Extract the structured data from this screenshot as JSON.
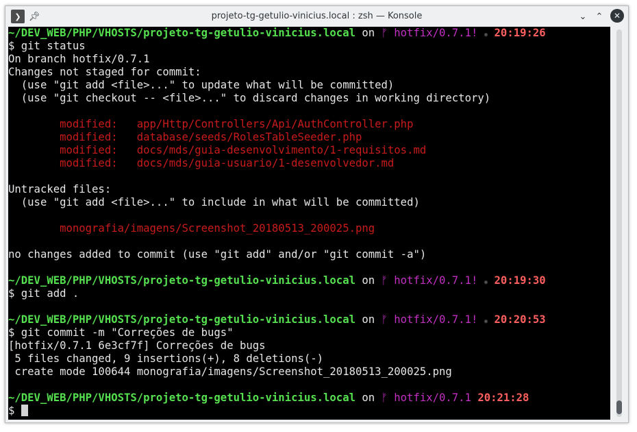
{
  "window": {
    "title": "projeto-tg-getulio-vinicius.local : zsh — Konsole"
  },
  "icons": {
    "menu": "terminal-menu-icon",
    "pin": "pin-icon",
    "minimize": "chevron-down-icon",
    "maximize": "chevron-up-icon",
    "close": "close-icon"
  },
  "colors": {
    "path": "#55e04f",
    "branch": "#c22fc2",
    "time": "#ff5f5f",
    "modified": "#c91b1b",
    "background": "#000000"
  },
  "terminal": {
    "prompt_path": "~/DEV_WEB/PHP/VHOSTS/projeto-tg-getulio-vinicius.local",
    "on": "on",
    "branch_glyph": "ᚠ",
    "dirty_marker": "◉",
    "prompts": [
      {
        "branch": "hotfix/0.7.1!",
        "time": "20:19:26",
        "command": "$ git status"
      },
      {
        "branch": "hotfix/0.7.1!",
        "time": "20:19:30",
        "command": "$ git add ."
      },
      {
        "branch": "hotfix/0.7.1!",
        "time": "20:20:53",
        "command": "$ git commit -m \"Correções de bugs\""
      },
      {
        "branch": "hotfix/0.7.1",
        "time": "20:21:28",
        "command": "$ "
      }
    ],
    "status_output": {
      "l1": "On branch hotfix/0.7.1",
      "l2": "Changes not staged for commit:",
      "l3": "  (use \"git add <file>...\" to update what will be committed)",
      "l4": "  (use \"git checkout -- <file>...\" to discard changes in working directory)",
      "modified": [
        "        modified:   app/Http/Controllers/Api/AuthController.php",
        "        modified:   database/seeds/RolesTableSeeder.php",
        "        modified:   docs/mds/guia-desenvolvimento/1-requisitos.md",
        "        modified:   docs/mds/guia-usuario/1-desenvolvedor.md"
      ],
      "untracked_header": "Untracked files:",
      "untracked_hint": "  (use \"git add <file>...\" to include in what will be committed)",
      "untracked_file": "        monografia/imagens/Screenshot_20180513_200025.png",
      "summary": "no changes added to commit (use \"git add\" and/or \"git commit -a\")"
    },
    "commit_output": [
      "[hotfix/0.7.1 6e3cf7f] Correções de bugs",
      " 5 files changed, 9 insertions(+), 8 deletions(-)",
      " create mode 100644 monografia/imagens/Screenshot_20180513_200025.png"
    ]
  }
}
